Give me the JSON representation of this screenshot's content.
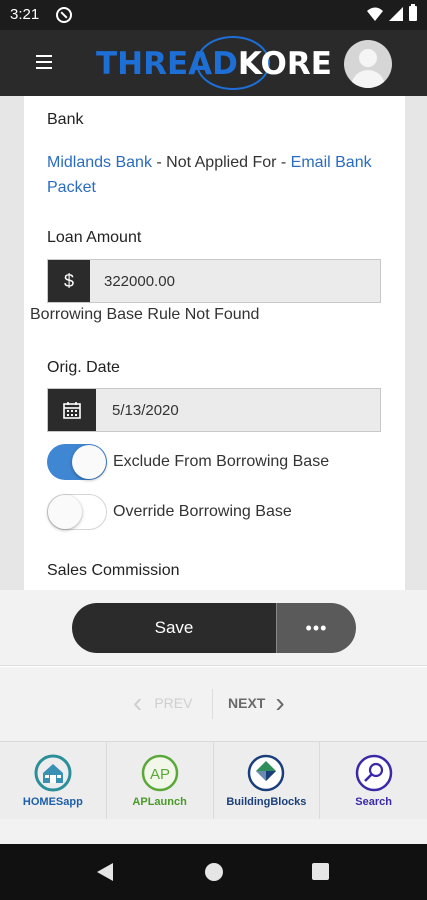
{
  "status_bar": {
    "time": "3:21"
  },
  "header": {
    "logo_part1": "THREAD",
    "logo_part2": "KORE"
  },
  "form": {
    "bank_label": "Bank",
    "bank_link": "Midlands Bank",
    "bank_status": " - Not Applied For - ",
    "bank_action": "Email Bank Packet",
    "loan_label": "Loan Amount",
    "loan_prefix": "$",
    "loan_value": "322000.00",
    "borrowing_note": "Borrowing Base Rule Not Found",
    "orig_label": "Orig. Date",
    "orig_value": "5/13/2020",
    "toggle_exclude_label": "Exclude From Borrowing Base",
    "toggle_exclude_on": true,
    "toggle_override_label": "Override Borrowing Base",
    "toggle_override_on": false,
    "sales_label": "Sales Commission"
  },
  "actions": {
    "save_label": "Save",
    "more_label": "•••"
  },
  "pager": {
    "prev_label": "PREV",
    "next_label": "NEXT"
  },
  "apps": [
    {
      "name": "HOMESapp",
      "color": "#1d5fa8",
      "icon": "house-icon"
    },
    {
      "name": "APLaunch",
      "color": "#4a9a2a",
      "icon": "ap-icon"
    },
    {
      "name": "BuildingBlocks",
      "color": "#1a3f7a",
      "icon": "blocks-icon"
    },
    {
      "name": "Search",
      "color": "#3a2aa8",
      "icon": "magnifier-icon"
    }
  ],
  "colors": {
    "accent": "#1d6fd6",
    "link": "#2a6cc1",
    "toggle_on": "#3f86d3",
    "header_bg": "#2a2a2a"
  }
}
